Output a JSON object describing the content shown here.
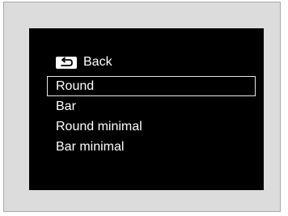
{
  "menu": {
    "back_label": "Back",
    "back_icon": "back-arrow-icon",
    "items": [
      {
        "label": "Round",
        "selected": true
      },
      {
        "label": "Bar",
        "selected": false
      },
      {
        "label": "Round minimal",
        "selected": false
      },
      {
        "label": "Bar minimal",
        "selected": false
      }
    ]
  },
  "colors": {
    "screen_background": "#000000",
    "frame_background": "#dcdcdc",
    "text": "#ffffff",
    "selection_border": "#e6e6e6"
  }
}
